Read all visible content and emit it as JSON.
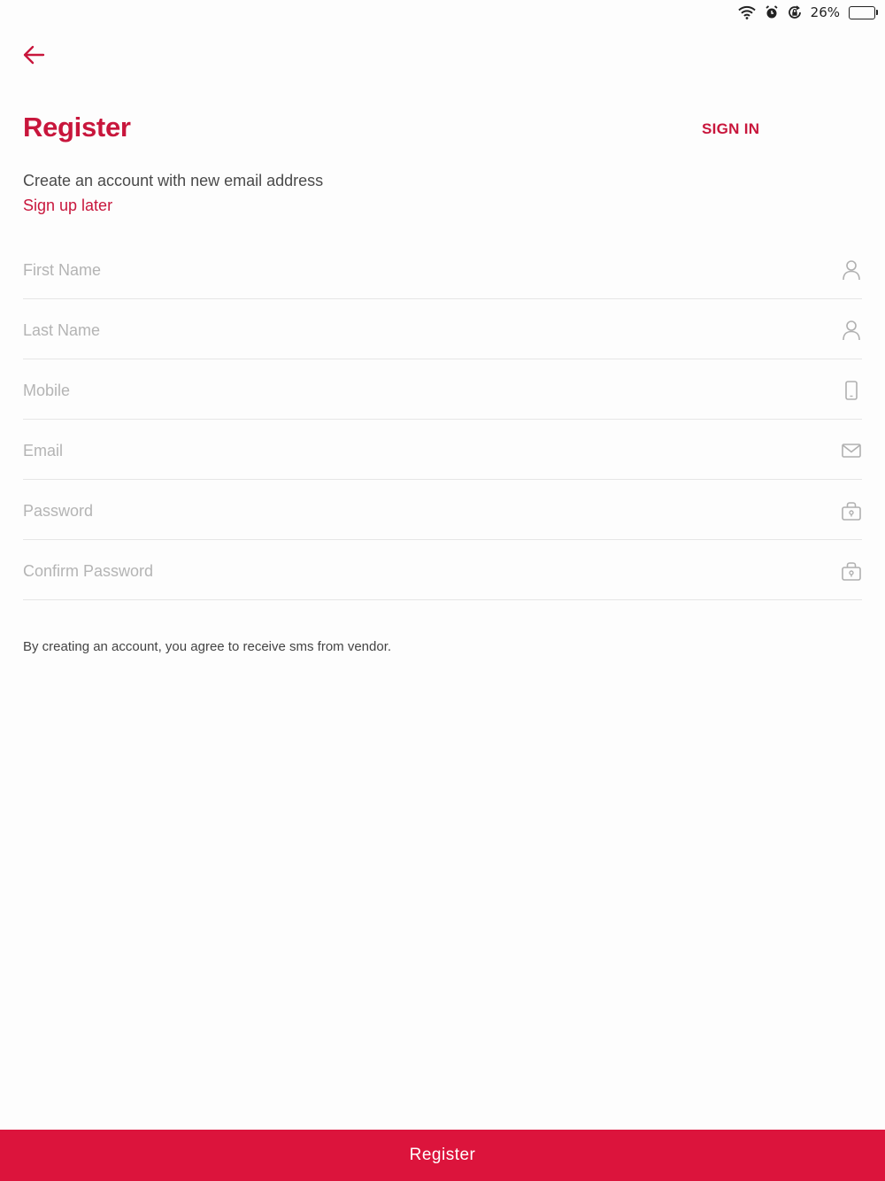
{
  "colors": {
    "accent": "#c8163c",
    "button_bg": "#dc143c",
    "divider": "#e6e6e6",
    "placeholder": "#b4b4b4",
    "icon": "#b0b0b0"
  },
  "status_bar": {
    "icons": [
      "wifi-icon",
      "alarm-icon",
      "rotation-lock-icon"
    ],
    "battery_percent_text": "26%",
    "battery_level": 0.26
  },
  "header": {
    "back_icon": "arrow-left-icon",
    "title": "Register",
    "sign_in_label": "SIGN IN",
    "subtitle": "Create an account with new email address",
    "sign_up_later_label": "Sign up later"
  },
  "form": {
    "fields": [
      {
        "placeholder": "First Name",
        "value": "",
        "icon": "person-icon"
      },
      {
        "placeholder": "Last Name",
        "value": "",
        "icon": "person-icon"
      },
      {
        "placeholder": "Mobile",
        "value": "",
        "icon": "phone-icon"
      },
      {
        "placeholder": "Email",
        "value": "",
        "icon": "envelope-icon"
      },
      {
        "placeholder": "Password",
        "value": "",
        "icon": "lock-icon"
      },
      {
        "placeholder": "Confirm Password",
        "value": "",
        "icon": "lock-icon"
      }
    ]
  },
  "terms_text": "By creating an account, you agree to receive sms from vendor.",
  "register_button_label": "Register"
}
